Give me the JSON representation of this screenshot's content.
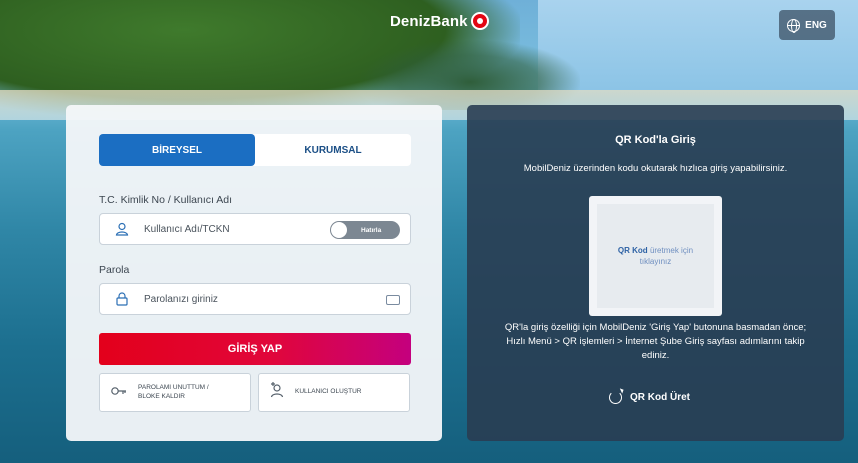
{
  "header": {
    "brand": "DenizBank",
    "language_button": "ENG",
    "icons": {
      "brand": "denizbank-logo-icon",
      "language": "globe-icon"
    }
  },
  "login": {
    "tabs": [
      {
        "label": "BİREYSEL",
        "active": true
      },
      {
        "label": "KURUMSAL",
        "active": false
      }
    ],
    "username": {
      "label": "T.C. Kimlik No / Kullanıcı Adı",
      "placeholder": "Kullanıcı Adı/TCKN",
      "remember_label": "Hatırla",
      "icon": "user-icon"
    },
    "password": {
      "label": "Parola",
      "placeholder": "Parolanızı giriniz",
      "icon": "lock-icon",
      "keyboard_icon": "keyboard-icon"
    },
    "submit": "GİRİŞ YAP",
    "forgot": {
      "line1": "PAROLAMI UNUTTUM /",
      "line2": "BLOKE KALDIR",
      "icon": "key-icon"
    },
    "create_user": {
      "label": "KULLANICI OLUŞTUR",
      "icon": "add-user-icon"
    }
  },
  "qr": {
    "title": "QR Kod'la Giriş",
    "description": "MobilDeniz üzerinden kodu okutarak hızlıca giriş yapabilirsiniz.",
    "box_bold": "QR Kod",
    "box_text_1": "üretmek için",
    "box_text_2": "tıklayınız",
    "info": "QR'la giriş özelliği için MobilDeniz 'Giriş Yap' butonuna basmadan önce; Hızlı Menü > QR işlemleri > İnternet Şube Giriş sayfası adımlarını takip ediniz.",
    "action": "QR Kod Üret",
    "action_icon": "refresh-icon"
  },
  "colors": {
    "primary_blue": "#1b6ec2",
    "submit_start": "#e3001b",
    "submit_end": "#c4007e",
    "qr_panel": "#293d52"
  }
}
